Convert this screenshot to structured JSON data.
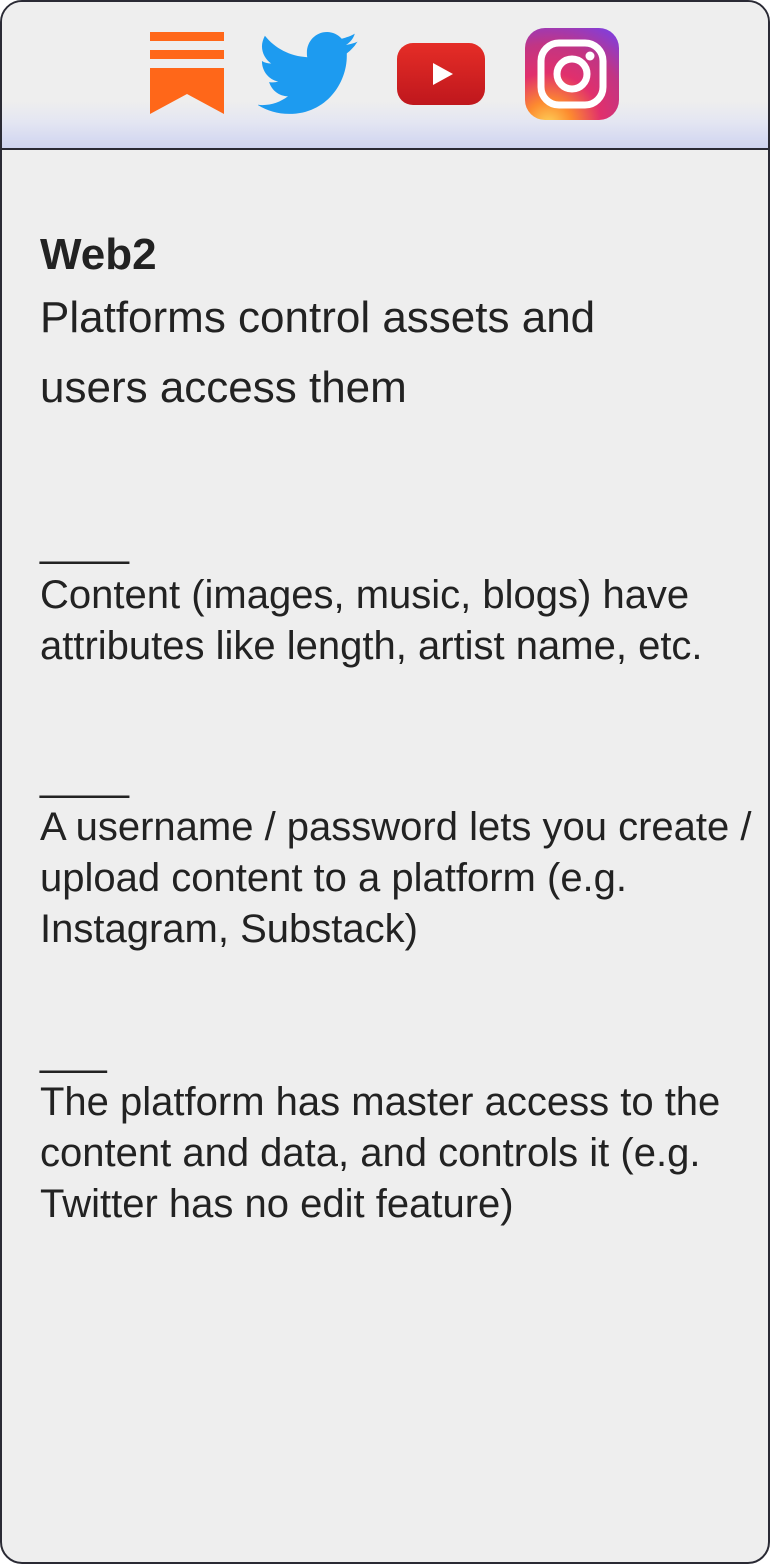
{
  "header": {
    "icons": [
      "substack-icon",
      "twitter-icon",
      "youtube-icon",
      "instagram-icon"
    ],
    "colors": {
      "substack": "#ff6719",
      "twitter": "#1d9bf0",
      "youtube": "#d9201e",
      "instagram_start": "#fdd35a",
      "instagram_mid": "#e1306c",
      "instagram_end": "#7b3fe4"
    }
  },
  "card": {
    "title": "Web2",
    "subtitle_line1": "Platforms control assets and",
    "subtitle_line2": "users access them",
    "separator1": "____",
    "paragraph1": "Content (images, music, blogs) have attributes like length, artist name, etc.",
    "separator2": "____",
    "paragraph2": "A username / password lets you create / upload content to a platform (e.g. Instagram, Substack)",
    "separator3": "___",
    "paragraph3": "The platform has master access to the content and data, and controls it (e.g. Twitter has no edit feature)"
  }
}
